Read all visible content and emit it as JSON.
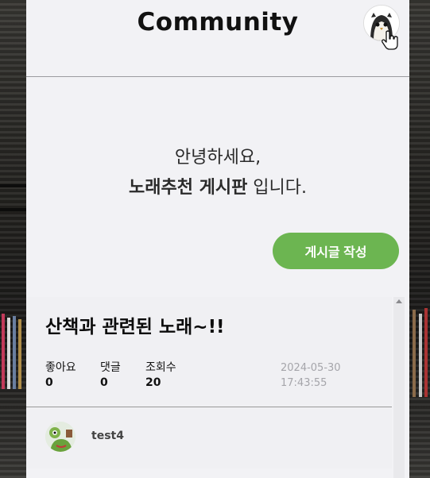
{
  "header": {
    "title": "Community",
    "avatar_icon": "owl-avatar-icon"
  },
  "greeting": {
    "line1": "안녕하세요,",
    "line2_bold": "노래추천 게시판",
    "line2_plain": " 입니다."
  },
  "write_button": {
    "label": "게시글 작성",
    "color": "#6cb551"
  },
  "posts": [
    {
      "title": "산책과 관련된 노래~!!",
      "likes_label": "좋아요",
      "likes": "0",
      "comments_label": "댓글",
      "comments": "0",
      "views_label": "조회수",
      "views": "20",
      "date": "2024-05-30",
      "time": "17:43:55",
      "author": "test4",
      "author_avatar_icon": "frog-avatar-icon"
    }
  ],
  "colors": {
    "panel_bg": "#f2f2f5",
    "accent_green": "#6cb551",
    "date_text": "#a5a5aa"
  }
}
